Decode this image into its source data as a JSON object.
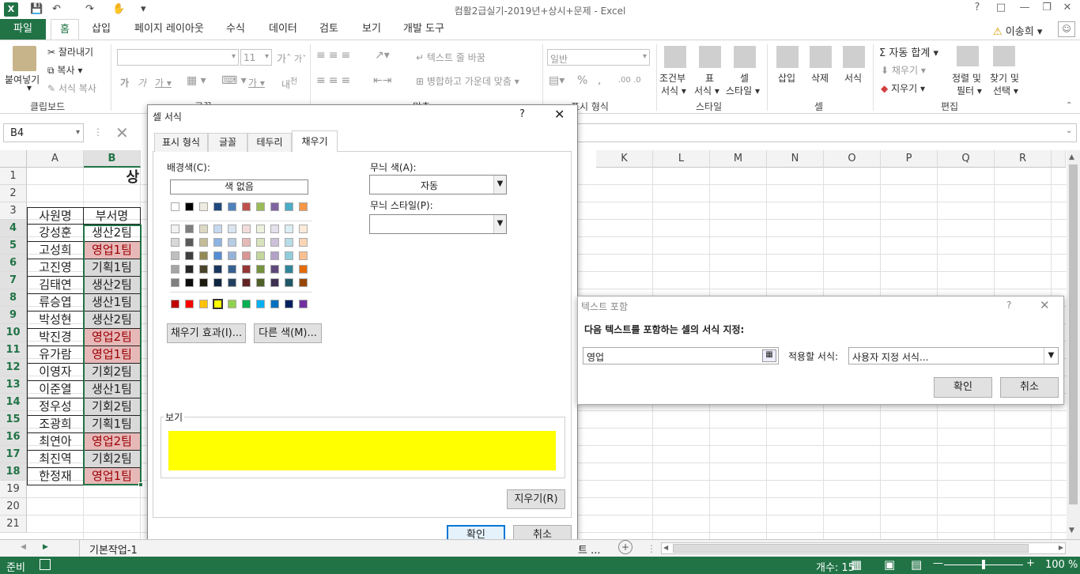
{
  "title": "컴활2급실기-2019년+상시+문제 - Excel",
  "user": "이송희",
  "tabs": [
    "파일",
    "홈",
    "삽입",
    "페이지 레이아웃",
    "수식",
    "데이터",
    "검토",
    "보기",
    "개발 도구"
  ],
  "ribbon": {
    "paste": "붙여넣기",
    "cut": "잘라내기",
    "copy": "복사",
    "format_painter": "서식 복사",
    "g_clipboard": "클립보드",
    "g_font": "글꼴",
    "g_align": "맞춤",
    "g_number": "표시 형식",
    "g_style": "스타일",
    "g_cells": "셀",
    "g_edit": "편집",
    "font_size": "11",
    "wrap": "텍스트 줄 바꿈",
    "merge": "병합하고 가운데 맞춤",
    "number_format": "일반",
    "cond1": "조건부",
    "cond2": "서식",
    "table1": "표",
    "table2": "서식",
    "cellstyle1": "셀",
    "cellstyle2": "스타일",
    "insert": "삽입",
    "delete": "삭제",
    "format": "서식",
    "autosum": "자동 합계",
    "fill": "채우기",
    "clear": "지우기",
    "sort1": "정렬 및",
    "sort2": "필터",
    "find1": "찾기 및",
    "find2": "선택"
  },
  "namebox": "B4",
  "columns": [
    "A",
    "B",
    "K",
    "L",
    "M",
    "N",
    "O",
    "P",
    "Q",
    "R"
  ],
  "rows": [
    "1",
    "2",
    "3",
    "4",
    "5",
    "6",
    "7",
    "8",
    "9",
    "10",
    "11",
    "12",
    "13",
    "14",
    "15",
    "16",
    "17",
    "18",
    "19",
    "20",
    "21"
  ],
  "title_cell": "상",
  "headers": {
    "a": "사원명",
    "b": "부서명"
  },
  "data": [
    {
      "name": "강성훈",
      "dept": "생산2팀",
      "style": "none"
    },
    {
      "name": "고성희",
      "dept": "영업1팀",
      "style": "pink"
    },
    {
      "name": "고진영",
      "dept": "기획1팀",
      "style": "gray"
    },
    {
      "name": "김태연",
      "dept": "생산2팀",
      "style": "gray"
    },
    {
      "name": "류승엽",
      "dept": "생산1팀",
      "style": "gray"
    },
    {
      "name": "박성현",
      "dept": "생산2팀",
      "style": "gray"
    },
    {
      "name": "박진경",
      "dept": "영업2팀",
      "style": "pink"
    },
    {
      "name": "유가람",
      "dept": "영업1팀",
      "style": "pink"
    },
    {
      "name": "이영자",
      "dept": "기회2팀",
      "style": "gray"
    },
    {
      "name": "이준열",
      "dept": "생산1팀",
      "style": "gray"
    },
    {
      "name": "정우성",
      "dept": "기회2팀",
      "style": "gray"
    },
    {
      "name": "조광희",
      "dept": "기획1팀",
      "style": "gray"
    },
    {
      "name": "최연아",
      "dept": "영업2팀",
      "style": "pink"
    },
    {
      "name": "최진역",
      "dept": "기회2팀",
      "style": "gray"
    },
    {
      "name": "한정재",
      "dept": "영업1팀",
      "style": "pink"
    }
  ],
  "format_dialog": {
    "title": "셀 서식",
    "help": "?",
    "tabs": [
      "표시 형식",
      "글꼴",
      "테두리",
      "채우기"
    ],
    "bg_color_label": "배경색(C):",
    "no_color": "색 없음",
    "pattern_color_label": "무늬 색(A):",
    "pattern_color_value": "자동",
    "pattern_style_label": "무늬 스타일(P):",
    "fill_effects": "채우기 효과(I)...",
    "more_colors": "다른 색(M)...",
    "sample_label": "보기",
    "sample_color": "#ffff00",
    "clear": "지우기(R)",
    "ok": "확인",
    "cancel": "취소"
  },
  "text_dialog": {
    "title": "텍스트 포함",
    "help": "?",
    "prompt": "다음 텍스트를 포함하는 셀의 서식 지정:",
    "value": "영업",
    "apply_label": "적용할 서식:",
    "apply_value": "사용자 지정 서식...",
    "ok": "확인",
    "cancel": "취소"
  },
  "sheet_tab": "기본작업-1",
  "sheet_tab_more": "트",
  "status": {
    "ready": "준비",
    "count": "개수: 15",
    "zoom": "100 %"
  },
  "colors": {
    "accent": "#217346",
    "selected_tab": "#0078d7",
    "pink_fill": "#e6b8b7",
    "gray_fill": "#d9d9d9"
  }
}
